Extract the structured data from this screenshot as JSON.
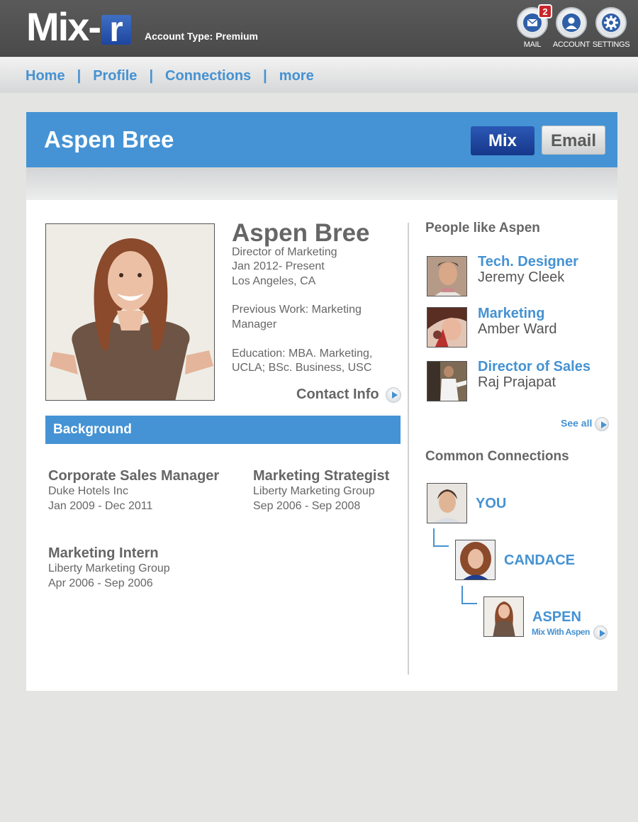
{
  "app": {
    "logo_main": "Mix-",
    "logo_box": "r",
    "account_type": "Account Type: Premium"
  },
  "top_icons": {
    "mail_label": "MAIL",
    "mail_badge": "2",
    "account_label": "ACCOUNT",
    "settings_label": "SETTINGS"
  },
  "nav": {
    "items": [
      "Home",
      "Profile",
      "Connections",
      "more"
    ],
    "separator": "|"
  },
  "header": {
    "name": "Aspen Bree",
    "mix_button": "Mix",
    "email_button": "Email"
  },
  "profile": {
    "name": "Aspen Bree",
    "title": "Director of Marketing",
    "dates": "Jan 2012- Present",
    "location": "Los Angeles, CA",
    "previous_work_1": "Previous Work: Marketing",
    "previous_work_2": "Manager",
    "education_1": "Education: MBA. Marketing,",
    "education_2": "UCLA; BSc. Business, USC",
    "contact_info": "Contact Info"
  },
  "background": {
    "heading": "Background",
    "jobs": [
      {
        "title": "Corporate Sales Manager",
        "company": "Duke Hotels Inc",
        "dates": "Jan 2009 - Dec 2011"
      },
      {
        "title": "Marketing Strategist",
        "company": "Liberty Marketing Group",
        "dates": "Sep 2006 - Sep 2008"
      },
      {
        "title": "Marketing Intern",
        "company": "Liberty Marketing Group",
        "dates": "Apr 2006 - Sep 2006"
      }
    ]
  },
  "people_like": {
    "heading": "People like Aspen",
    "people": [
      {
        "role": "Tech. Designer",
        "name": "Jeremy Cleek"
      },
      {
        "role": "Marketing",
        "name": "Amber Ward"
      },
      {
        "role": "Director of Sales",
        "name": "Raj Prajapat"
      }
    ],
    "see_all": "See all"
  },
  "common_connections": {
    "heading": "Common Connections",
    "chain": [
      "YOU",
      "CANDACE",
      "ASPEN"
    ],
    "mix_with": "Mix With Aspen"
  },
  "colors": {
    "accent_blue": "#4593d4",
    "mix_button": "#1e46a0",
    "topbar": "#505050",
    "badge_red": "#c9242b"
  }
}
